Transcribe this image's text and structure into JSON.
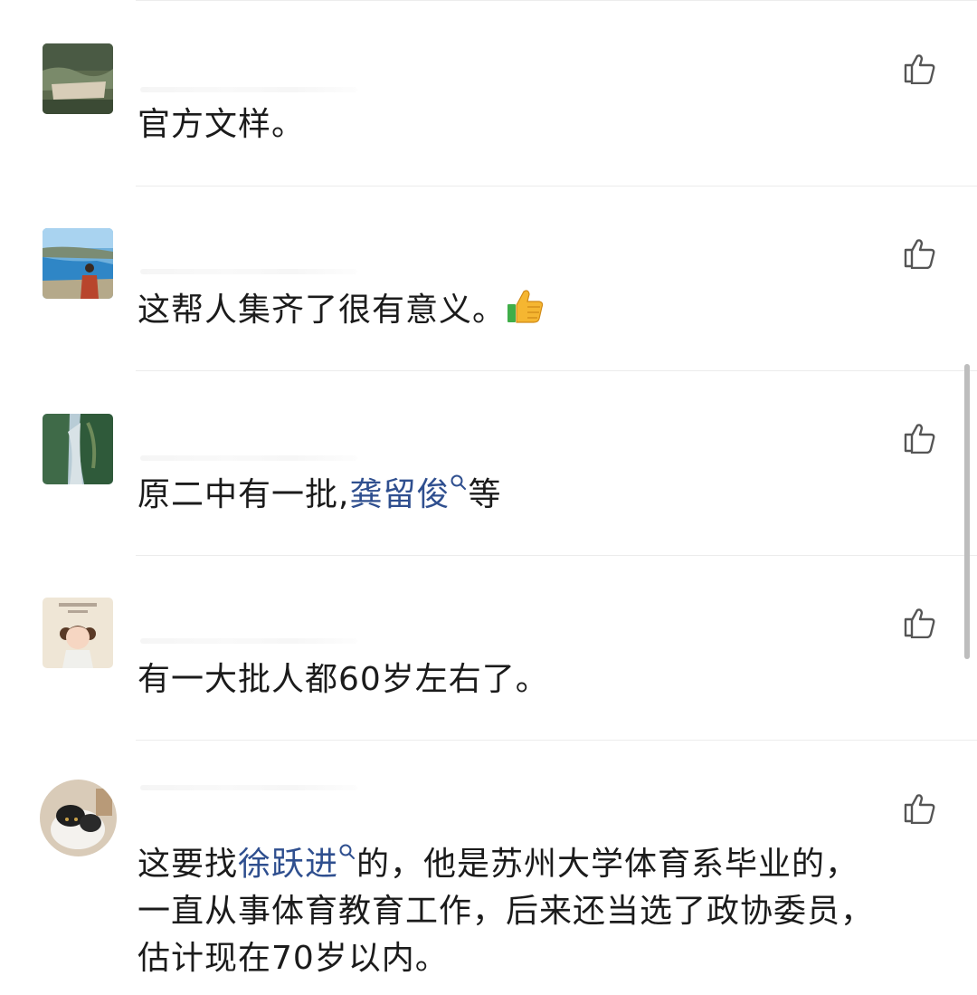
{
  "comments": [
    {
      "text": "官方文样。"
    },
    {
      "text": "这帮人集齐了很有意义。",
      "emoji": "thumbs-up-emoji"
    },
    {
      "text_before": "原二中有一批,",
      "link": "龚留俊",
      "text_after": "等"
    },
    {
      "text": "有一大批人都60岁左右了。"
    },
    {
      "text_before": "这要找",
      "link": "徐跃进",
      "text_after": "的，他是苏州大学体育系毕业的，",
      "line2": "一直从事体育教育工作，后来还当选了政协委员，",
      "line3": "估计现在70岁以内。"
    }
  ],
  "icons": {
    "like": "thumbs-up-outline-icon",
    "search": "search-icon"
  },
  "colors": {
    "link": "#2f4f8f",
    "divider": "#ececec",
    "text": "#1b1b1b",
    "icon": "#555555"
  }
}
